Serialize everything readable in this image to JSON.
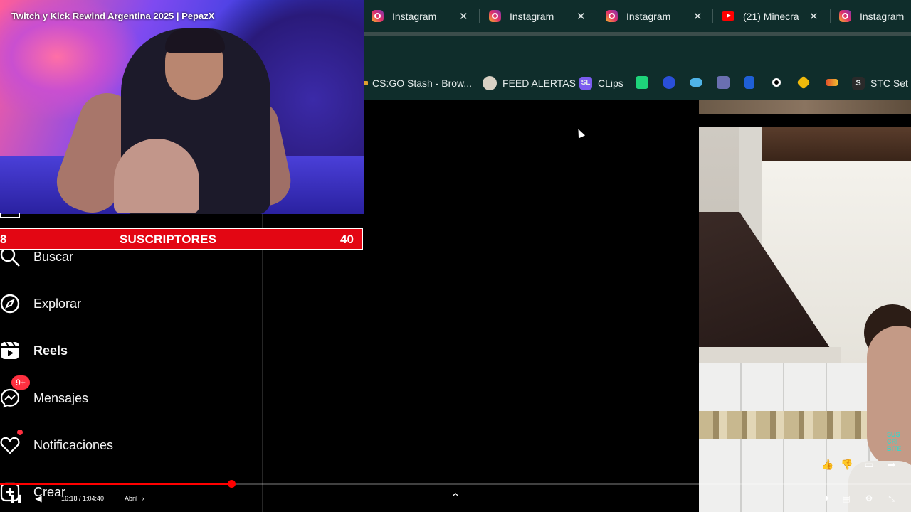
{
  "webcam": {
    "title": "Twitch y Kick Rewind Argentina 2025 | PepazX"
  },
  "tabs": [
    {
      "label": "Instagram",
      "icon": "instagram-icon"
    },
    {
      "label": "Instagram",
      "icon": "instagram-icon"
    },
    {
      "label": "Instagram",
      "icon": "instagram-icon"
    },
    {
      "label": "(21) Minecra",
      "icon": "youtube-icon"
    },
    {
      "label": "Instagram",
      "icon": "instagram-icon"
    }
  ],
  "bookmarks": [
    {
      "label": "CS:GO Stash - Brow..."
    },
    {
      "label": "FEED ALERTAS"
    },
    {
      "label": "CLips",
      "icon_text": "SL"
    },
    {
      "label": "STC Set P",
      "icon_text": "S"
    }
  ],
  "subscribers": {
    "left": "8",
    "label": "SUSCRIPTORES",
    "right": "40"
  },
  "sidebar": {
    "items": [
      {
        "label": "Buscar",
        "icon": "search-icon"
      },
      {
        "label": "Explorar",
        "icon": "compass-icon"
      },
      {
        "label": "Reels",
        "icon": "reels-icon"
      },
      {
        "label": "Mensajes",
        "icon": "messenger-icon",
        "badge": "9+"
      },
      {
        "label": "Notificaciones",
        "icon": "heart-icon"
      },
      {
        "label": "Crear",
        "icon": "plus-square-icon"
      }
    ]
  },
  "reel": {
    "watermark": "SUS\nCRI\nBITE"
  },
  "player": {
    "time": "16:18 / 1:04:40",
    "chapter": "Abril",
    "progress": 0.2536
  },
  "colors": {
    "accent": "#e30613",
    "instagram_notification": "#ff3040",
    "tabbar": "#0f2d2b"
  }
}
